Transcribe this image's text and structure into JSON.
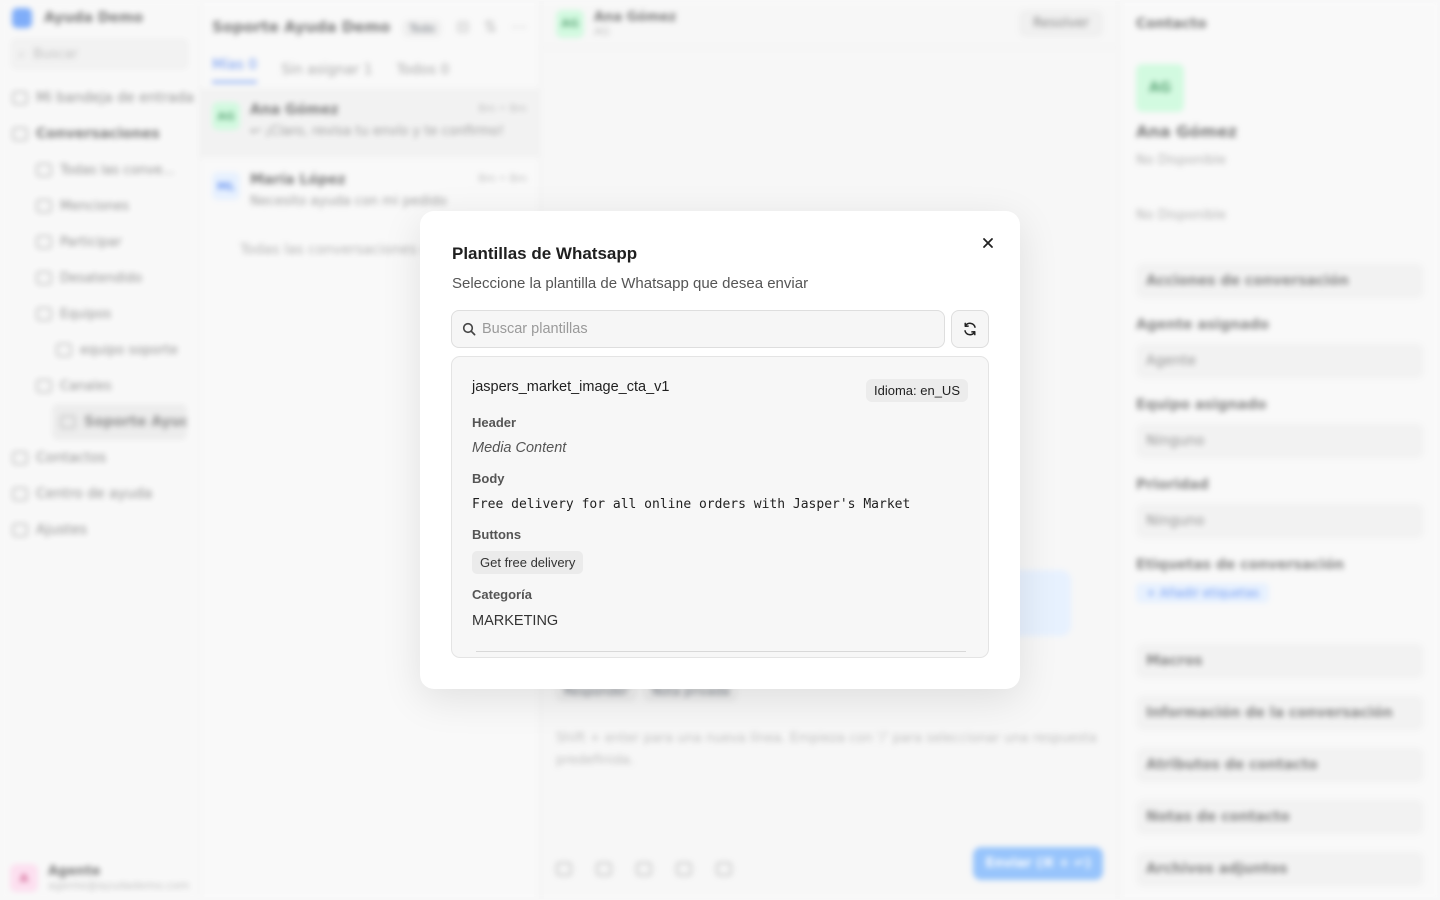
{
  "background": {
    "sidebar": {
      "brand": "Ayuda Demo",
      "search_placeholder": "Buscar",
      "items": [
        {
          "label": "Mi bandeja de entrada",
          "level": 0
        },
        {
          "label": "Conversaciones",
          "level": 0,
          "bold": true
        },
        {
          "label": "Todas las conve...",
          "level": 1
        },
        {
          "label": "Menciones",
          "level": 1
        },
        {
          "label": "Participar",
          "level": 1
        },
        {
          "label": "Desatendido",
          "level": 1
        },
        {
          "label": "Equipos",
          "level": 1
        },
        {
          "label": "equipo soporte",
          "level": 2
        },
        {
          "label": "Canales",
          "level": 1
        },
        {
          "label": "Soporte Ayud...",
          "level": 2,
          "active": true
        },
        {
          "label": "Contactos",
          "level": 0
        },
        {
          "label": "Centro de ayuda",
          "level": 0
        },
        {
          "label": "Ajustes",
          "level": 0
        }
      ],
      "footer_name": "Agente",
      "footer_email": "agente@ayudademo.com"
    },
    "conversation_list": {
      "title": "Soporte Ayuda Demo",
      "badge": "Todo",
      "tabs": [
        {
          "label": "Mías 0"
        },
        {
          "label": "Sin asignar 1"
        },
        {
          "label": "Todos 0"
        }
      ],
      "conversations": [
        {
          "initials": "AG",
          "name": "Ana Gómez",
          "time": "8m • 8m",
          "message": "↩ ¡Claro, revisa tu envío y te confirmo!"
        },
        {
          "initials": "ML",
          "name": "María López",
          "time": "8m • 8m",
          "message": "Necesito ayuda con mi pedido"
        }
      ],
      "note": "Todas las conversaciones cargadas"
    },
    "chat": {
      "name": "Ana Gómez",
      "sub": "AG",
      "resolve_label": "Resolver",
      "reply_tab": "Responder",
      "private_tab": "Nota privada",
      "input_placeholder": "Shift + enter para una nueva línea. Empieza con '/' para seleccionar una respuesta predefinida.",
      "send_label": "Enviar (⌘ + ↵)"
    },
    "contact": {
      "title": "Contacto",
      "initials": "AG",
      "name": "Ana Gómez",
      "email": "No Disponible",
      "phone": "No Disponible",
      "actions_title": "Acciones de conversación",
      "agent_label": "Agente asignado",
      "agent_value": "Agente",
      "team_label": "Equipo asignado",
      "team_value": "Ninguno",
      "priority_label": "Prioridad",
      "priority_value": "Ninguno",
      "tags_label": "Etiquetas de conversación",
      "add_tag": "+ Añadir etiquetas",
      "sections": [
        "Macros",
        "Información de la conversación",
        "Atributos de contacto",
        "Notas de contacto",
        "Archivos adjuntos"
      ]
    }
  },
  "modal": {
    "title": "Plantillas de Whatsapp",
    "description": "Seleccione la plantilla de Whatsapp que desea enviar",
    "search_placeholder": "Buscar plantillas",
    "template": {
      "name": "jaspers_market_image_cta_v1",
      "language": "Idioma: en_US",
      "header_label": "Header",
      "header_value": "Media Content",
      "body_label": "Body",
      "body_value": "Free delivery for all online orders with Jasper's Market",
      "buttons_label": "Buttons",
      "button_text": "Get free delivery",
      "category_label": "Categoría",
      "category_value": "MARKETING"
    }
  },
  "icons": [
    "close-icon",
    "search-icon",
    "refresh-icon"
  ],
  "colors": {
    "accent": "#2563eb",
    "modal_bg": "#ffffff",
    "card_bg": "#f7f7f7"
  }
}
